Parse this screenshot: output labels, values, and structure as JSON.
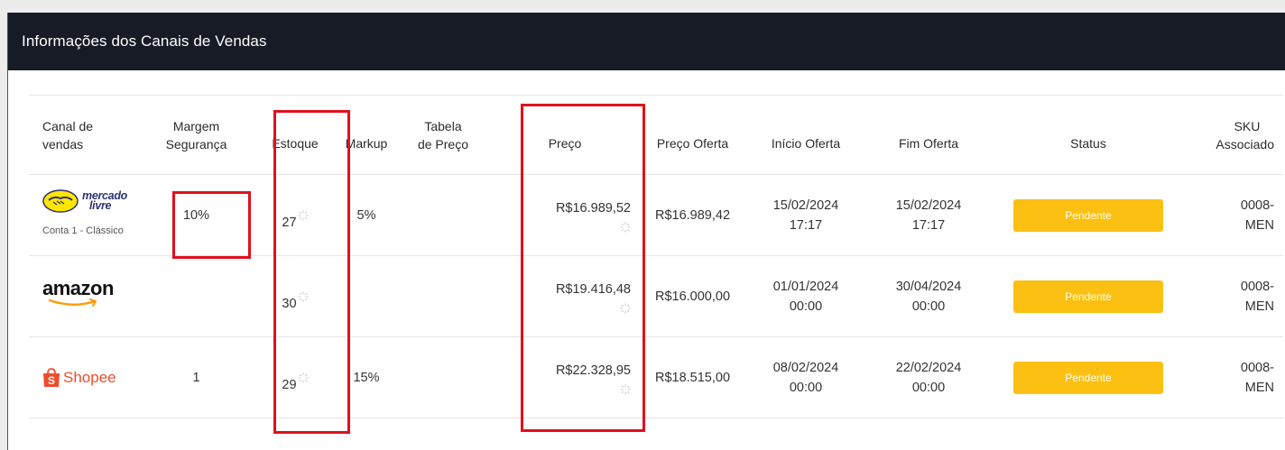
{
  "panel": {
    "title": "Informações dos Canais de Vendas"
  },
  "columns": {
    "canal": [
      "Canal de",
      "vendas"
    ],
    "margem": [
      "Margem",
      "Segurança"
    ],
    "estoque": "Estoque",
    "markup": "Markup",
    "tabela": [
      "Tabela",
      "de Preço"
    ],
    "preco": "Preço",
    "preco_oferta": "Preço Oferta",
    "inicio_oferta": "Início Oferta",
    "fim_oferta": "Fim Oferta",
    "status": "Status",
    "sku": [
      "SKU",
      "Associado"
    ]
  },
  "rows": [
    {
      "logo": "mercado-livre-logo",
      "logo_text": [
        "mercado",
        "livre"
      ],
      "note": "Conta 1 - Clássico",
      "margem": "10%",
      "estoque": "27",
      "markup": "5%",
      "tabela": "",
      "preco": "R$16.989,52",
      "preco_oferta": "R$16.989,42",
      "inicio": [
        "15/02/2024",
        "17:17"
      ],
      "fim": [
        "15/02/2024",
        "17:17"
      ],
      "status": "Pendente",
      "sku": [
        "0008-",
        "MEN"
      ]
    },
    {
      "logo": "amazon-logo",
      "logo_text": "amazon",
      "margem": "",
      "estoque": "30",
      "markup": "",
      "tabela": "",
      "preco": "R$19.416,48",
      "preco_oferta": "R$16.000,00",
      "inicio": [
        "01/01/2024",
        "00:00"
      ],
      "fim": [
        "30/04/2024",
        "00:00"
      ],
      "status": "Pendente",
      "sku": [
        "0008-",
        "MEN"
      ]
    },
    {
      "logo": "shopee-logo",
      "logo_text": "Shopee",
      "margem": "1",
      "estoque": "29",
      "markup": "15%",
      "tabela": "",
      "preco": "R$22.328,95",
      "preco_oferta": "R$18.515,00",
      "inicio": [
        "08/02/2024",
        "00:00"
      ],
      "fim": [
        "22/02/2024",
        "00:00"
      ],
      "status": "Pendente",
      "sku": [
        "0008-",
        "MEN"
      ]
    }
  ],
  "colors": {
    "header_bg": "#161b26",
    "status_bg": "#fbc012",
    "highlight": "#e0101c",
    "shopee": "#ee4d2d",
    "mercado_livre_yellow": "#ffe600",
    "mercado_livre_blue": "#2d3277"
  }
}
